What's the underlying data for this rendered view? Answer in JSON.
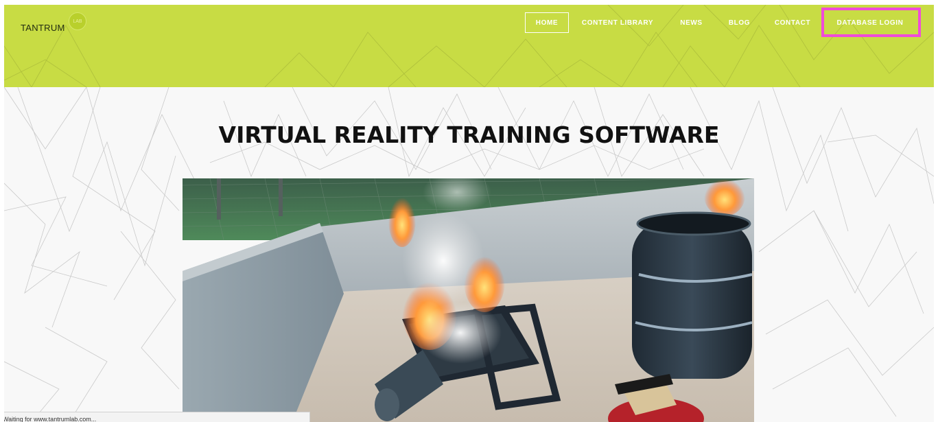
{
  "brand": {
    "name": "TANTRUM",
    "badge": "LAB",
    "color": "#c8dc44"
  },
  "nav": {
    "items": [
      {
        "label": "HOME",
        "active": true
      },
      {
        "label": "CONTENT LIBRARY",
        "active": false
      },
      {
        "label": "NEWS",
        "active": false
      },
      {
        "label": "BLOG",
        "active": false
      },
      {
        "label": "CONTACT",
        "active": false
      },
      {
        "label": "DATABASE LOGIN",
        "active": false,
        "highlighted": true
      }
    ],
    "highlight_color": "#f04bd8"
  },
  "main": {
    "title": "VIRTUAL REALITY TRAINING SOFTWARE",
    "hero_image": "vr-fire-extinguisher-training-scene"
  },
  "status": {
    "text": "Waiting for www.tantrumlab.com..."
  }
}
